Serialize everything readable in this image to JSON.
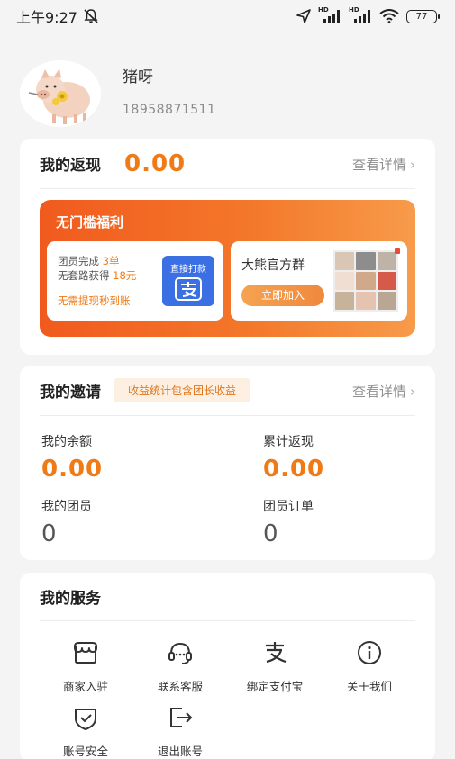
{
  "status_bar": {
    "time": "上午9:27",
    "network_1": "HD",
    "network_2": "HD",
    "battery": "77"
  },
  "profile": {
    "name": "猪呀",
    "phone": "18958871511"
  },
  "cashback": {
    "title": "我的返现",
    "amount": "0.00",
    "detail_link": "查看详情",
    "promo": {
      "title": "无门槛福利",
      "left": {
        "line1_prefix": "团员完成 ",
        "line1_highlight": "3单",
        "line2_prefix": "无套路获得 ",
        "line2_highlight": "18元",
        "line3": "无需提现秒到账",
        "button_label": "直接打款"
      },
      "right": {
        "title": "大熊官方群",
        "button_label": "立即加入"
      }
    }
  },
  "invite": {
    "title": "我的邀请",
    "badge": "收益统计包含团长收益",
    "detail_link": "查看详情",
    "stats": [
      {
        "label": "我的余额",
        "value": "0.00"
      },
      {
        "label": "累计返现",
        "value": "0.00"
      },
      {
        "label": "我的团员",
        "value": "0"
      },
      {
        "label": "团员订单",
        "value": "0"
      }
    ]
  },
  "services": {
    "title": "我的服务",
    "items": [
      {
        "label": "商家入驻",
        "icon": "store-icon"
      },
      {
        "label": "联系客服",
        "icon": "headset-icon"
      },
      {
        "label": "绑定支付宝",
        "icon": "alipay-icon"
      },
      {
        "label": "关于我们",
        "icon": "info-icon"
      },
      {
        "label": "账号安全",
        "icon": "shield-icon"
      },
      {
        "label": "退出账号",
        "icon": "logout-icon"
      }
    ]
  },
  "colors": {
    "accent": "#f07a16",
    "promo_gradient_start": "#f15a1e",
    "promo_gradient_end": "#f79b4a",
    "alipay_blue": "#3b6fe4"
  }
}
